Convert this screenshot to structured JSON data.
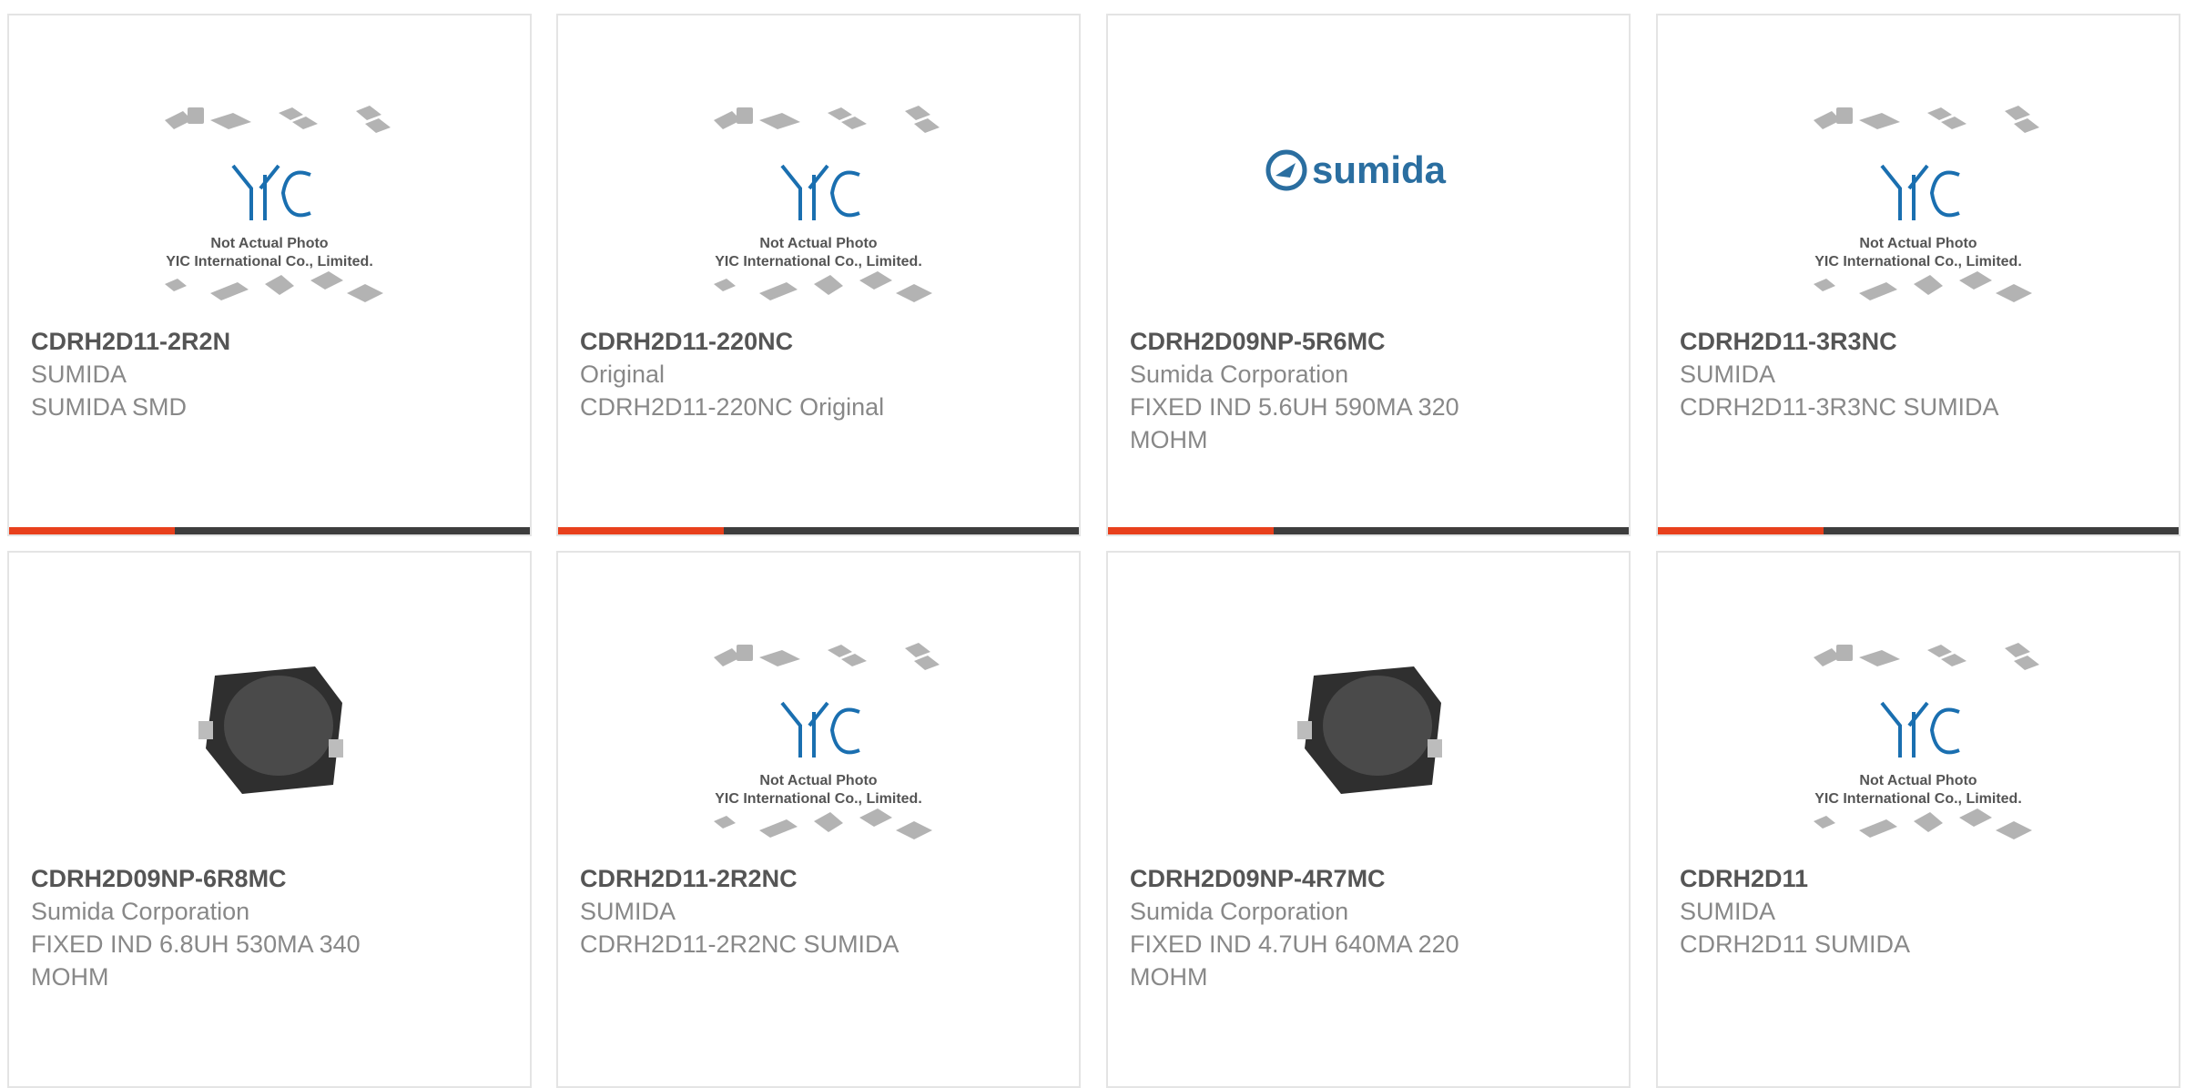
{
  "colors": {
    "accent": "#e8401c",
    "bar": "#3d3d3d",
    "yic_blue": "#1a6fb0",
    "sumida_blue": "#2a6ea0"
  },
  "products": [
    {
      "part_number": "CDRH2D11-2R2N",
      "manufacturer": "SUMIDA",
      "description": "SUMIDA SMD",
      "image": "yic-placeholder"
    },
    {
      "part_number": "CDRH2D11-220NC",
      "manufacturer": "Original",
      "description": "CDRH2D11-220NC Original",
      "image": "yic-placeholder"
    },
    {
      "part_number": "CDRH2D09NP-5R6MC",
      "manufacturer": "Sumida Corporation",
      "description": "FIXED IND 5.6UH 590MA 320 MOHM",
      "image": "sumida-logo"
    },
    {
      "part_number": "CDRH2D11-3R3NC",
      "manufacturer": "SUMIDA",
      "description": "CDRH2D11-3R3NC SUMIDA",
      "image": "yic-placeholder"
    },
    {
      "part_number": "CDRH2D09NP-6R8MC",
      "manufacturer": "Sumida Corporation",
      "description": "FIXED IND 6.8UH 530MA 340 MOHM",
      "image": "inductor-photo"
    },
    {
      "part_number": "CDRH2D11-2R2NC",
      "manufacturer": "SUMIDA",
      "description": "CDRH2D11-2R2NC SUMIDA",
      "image": "yic-placeholder"
    },
    {
      "part_number": "CDRH2D09NP-4R7MC",
      "manufacturer": "Sumida Corporation",
      "description": "FIXED IND 4.7UH 640MA 220 MOHM",
      "image": "inductor-photo"
    },
    {
      "part_number": "CDRH2D11",
      "manufacturer": "SUMIDA",
      "description": "CDRH2D11 SUMIDA",
      "image": "yic-placeholder"
    }
  ],
  "placeholder": {
    "logo_text": "YIC",
    "line1": "Not Actual Photo",
    "line2": "YIC International Co., Limited."
  },
  "sumida_logo_text": "sumida"
}
